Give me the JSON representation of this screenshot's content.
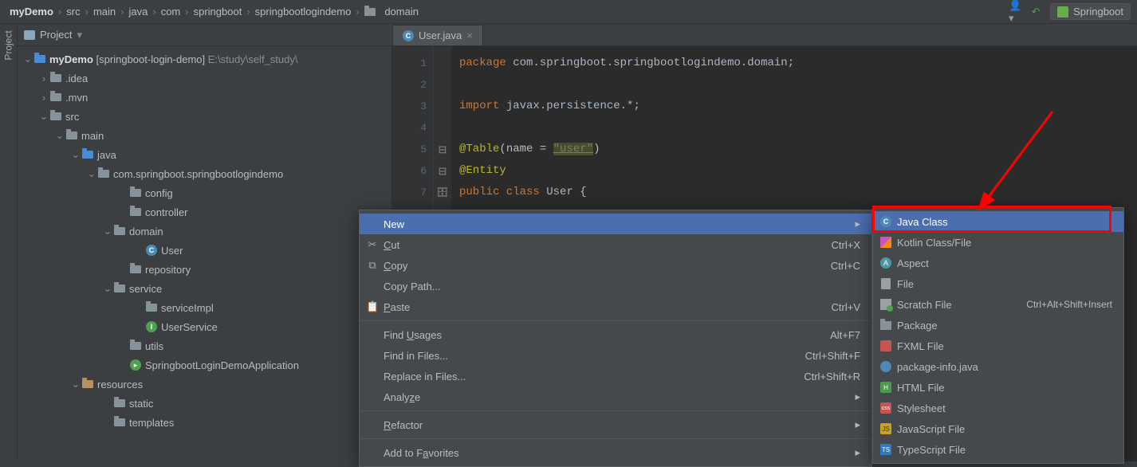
{
  "breadcrumb": [
    "myDemo",
    "src",
    "main",
    "java",
    "com",
    "springboot",
    "springbootlogindemo",
    "domain"
  ],
  "run_config": "Springboot",
  "toolbox": {
    "title": "Project"
  },
  "side_tab": "Project",
  "tree": {
    "root": "myDemo",
    "root_desc": "[springboot-login-demo]",
    "root_path": "E:\\study\\self_study\\",
    "idea": ".idea",
    "mvn": ".mvn",
    "src": "src",
    "main": "main",
    "java": "java",
    "pkg": "com.springboot.springbootlogindemo",
    "config": "config",
    "controller": "controller",
    "domain": "domain",
    "user": "User",
    "repository": "repository",
    "service": "service",
    "serviceImpl": "serviceImpl",
    "userService": "UserService",
    "utils": "utils",
    "app": "SpringbootLoginDemoApplication",
    "resources": "resources",
    "static": "static",
    "templates": "templates"
  },
  "tab": {
    "file": "User.java"
  },
  "code": {
    "l1_kw": "package",
    "l1_pkg": "com.springboot.springbootlogindemo.domain",
    "l3_kw": "import",
    "l3_pkg": "javax.persistence.*",
    "l5_ann": "@Table",
    "l5_arg": "(name = ",
    "l5_str": "\"user\"",
    "l5_end": ")",
    "l6_ann": "@Entity",
    "l7_kw": "public class",
    "l7_cls": "User",
    "l7_end": " {"
  },
  "context": {
    "new": "New",
    "cut": "Cut",
    "cut_s": "Ctrl+X",
    "copy": "Copy",
    "copy_s": "Ctrl+C",
    "copypath": "Copy Path...",
    "paste": "Paste",
    "paste_s": "Ctrl+V",
    "findusages": "Find Usages",
    "findusages_s": "Alt+F7",
    "findinfiles": "Find in Files...",
    "findinfiles_s": "Ctrl+Shift+F",
    "replaceinfiles": "Replace in Files...",
    "replaceinfiles_s": "Ctrl+Shift+R",
    "analyze": "Analyze",
    "refactor": "Refactor",
    "favorites": "Add to Favorites"
  },
  "submenu": {
    "javaclass": "Java Class",
    "kotlin": "Kotlin Class/File",
    "aspect": "Aspect",
    "file": "File",
    "scratch": "Scratch File",
    "scratch_s": "Ctrl+Alt+Shift+Insert",
    "package": "Package",
    "fxml": "FXML File",
    "pkginfo": "package-info.java",
    "html": "HTML File",
    "css": "Stylesheet",
    "js": "JavaScript File",
    "ts": "TypeScript File"
  }
}
